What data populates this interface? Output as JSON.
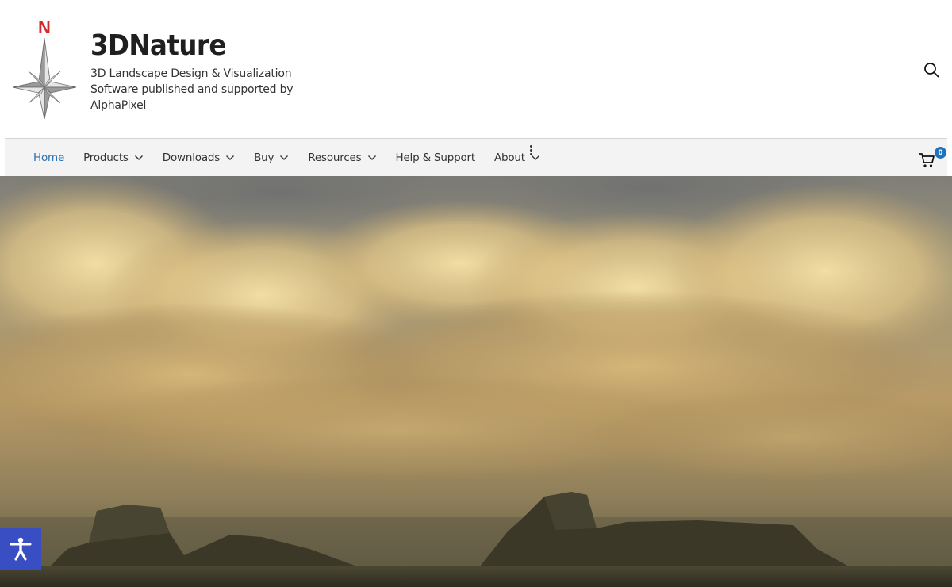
{
  "header": {
    "site_title": "3DNature",
    "tagline": "3D Landscape Design & Visualization Software published and supported by AlphaPixel",
    "logo_letter": "N",
    "logo_icon": "compass-star-icon",
    "search_icon": "search-icon"
  },
  "nav": {
    "items": [
      {
        "label": "Home",
        "active": true,
        "has_dropdown": false
      },
      {
        "label": "Products",
        "active": false,
        "has_dropdown": true
      },
      {
        "label": "Downloads",
        "active": false,
        "has_dropdown": true
      },
      {
        "label": "Buy",
        "active": false,
        "has_dropdown": true
      },
      {
        "label": "Resources",
        "active": false,
        "has_dropdown": true
      },
      {
        "label": "Help & Support",
        "active": false,
        "has_dropdown": false
      },
      {
        "label": "About",
        "active": false,
        "has_dropdown": true
      }
    ],
    "more_icon": "vertical-ellipsis-icon",
    "cart_icon": "shopping-cart-icon",
    "cart_count": "0"
  },
  "hero": {
    "image": "desert-mesas-under-golden-clouds-render"
  },
  "accessibility": {
    "icon": "accessibility-person-icon"
  },
  "colors": {
    "accent": "#2a6fb0",
    "badge": "#1e73be",
    "accessibility": "#3a4ec4",
    "nav_bg": "#f3f3f3",
    "logo_letter": "#d42a2a"
  }
}
